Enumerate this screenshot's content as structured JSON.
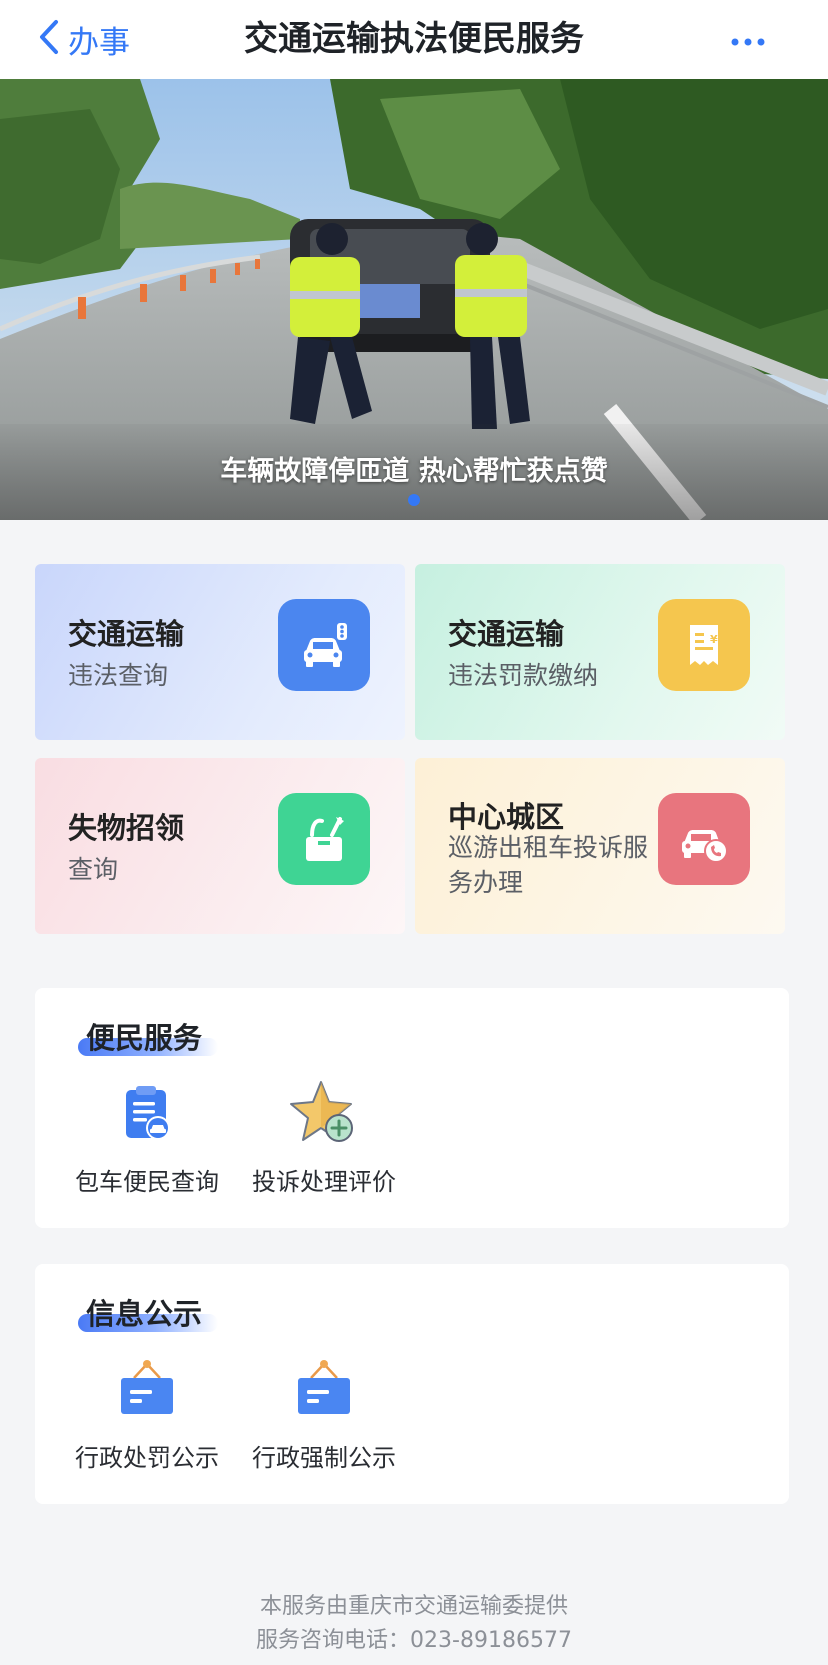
{
  "navbar": {
    "back_label": "办事",
    "title": "交通运输执法便民服务",
    "back_icon": "chevron-left-icon",
    "more_icon": "more-horizontal-icon"
  },
  "banner": {
    "caption": "车辆故障停匝道 热心帮忙获点赞",
    "active_dot": 1,
    "dot_count": 1
  },
  "quick_cards": [
    {
      "title": "交通运输",
      "subtitle": "违法查询",
      "icon": "car-signal-icon",
      "color": "#4b86ef"
    },
    {
      "title": "交通运输",
      "subtitle": "违法罚款缴纳",
      "icon": "receipt-yuan-icon",
      "color": "#f5c64e"
    },
    {
      "title": "失物招领",
      "subtitle": "查询",
      "icon": "lost-found-box-icon",
      "color": "#3fd494"
    },
    {
      "title": "中心城区",
      "subtitle": "巡游出租车投诉服务办理",
      "icon": "taxi-phone-icon",
      "color": "#e8757e"
    }
  ],
  "sections": {
    "bianmin": {
      "title": "便民服务",
      "items": [
        {
          "label": "包车便民查询",
          "icon": "clipboard-car-icon"
        },
        {
          "label": "投诉处理评价",
          "icon": "star-plus-icon"
        }
      ]
    },
    "xinxi": {
      "title": "信息公示",
      "items": [
        {
          "label": "行政处罚公示",
          "icon": "notice-board-icon"
        },
        {
          "label": "行政强制公示",
          "icon": "notice-board-icon"
        }
      ]
    }
  },
  "footer": {
    "provider": "本服务由重庆市交通运输委提供",
    "hotline": "服务咨询电话：023-89186577"
  },
  "colors": {
    "accent": "#3478f6",
    "background": "#f4f5f7"
  }
}
